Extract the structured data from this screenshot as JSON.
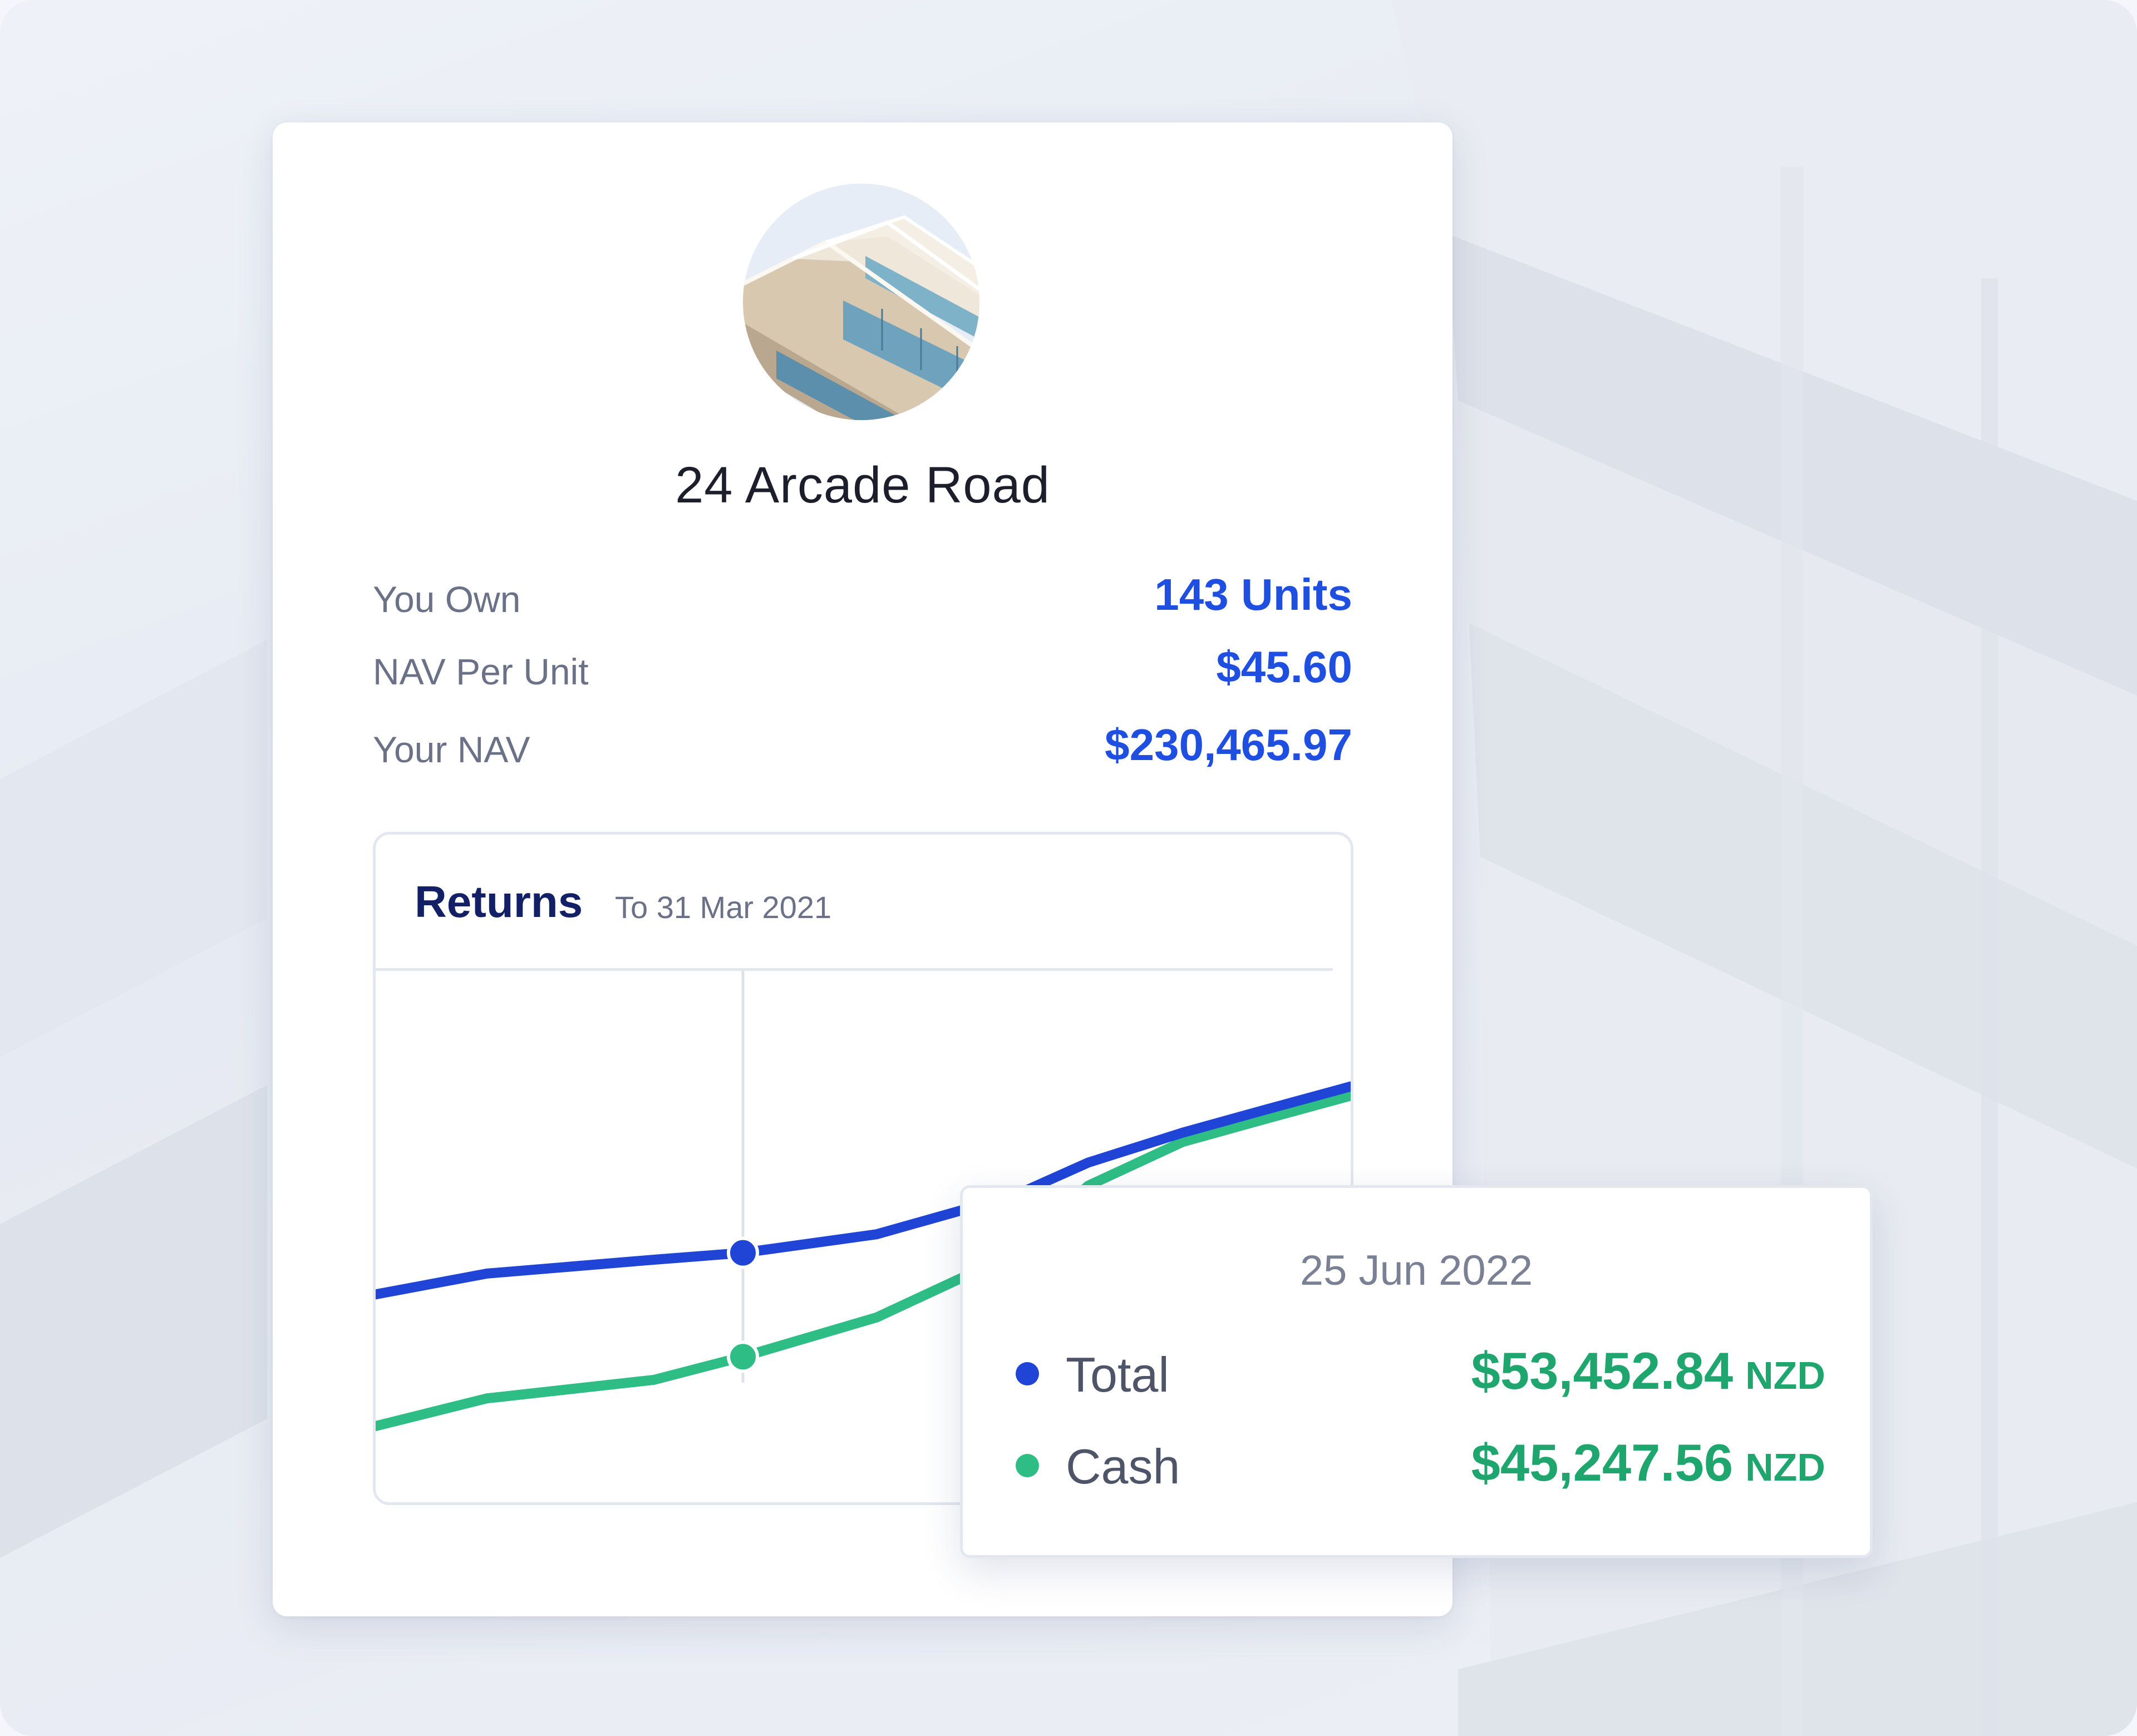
{
  "property": {
    "name": "24 Arcade Road",
    "image_icon": "building-photo"
  },
  "stats": [
    {
      "label": "You Own",
      "value": "143 Units"
    },
    {
      "label": "NAV Per Unit",
      "value": "$45.60"
    },
    {
      "label": "Your NAV",
      "value": "$230,465.97"
    }
  ],
  "returns": {
    "title": "Returns",
    "subtitle": "To 31 Mar 2021"
  },
  "tooltip": {
    "date": "25 Jun 2022",
    "rows": [
      {
        "label": "Total",
        "value": "$53,452.84",
        "currency": "NZD",
        "dot_color": "#1f44d6"
      },
      {
        "label": "Cash",
        "value": "$45,247.56",
        "currency": "NZD",
        "dot_color": "#2ebd85"
      }
    ]
  },
  "colors": {
    "accent_blue": "#1f44d6",
    "accent_green": "#2ebd85",
    "value_green": "#1fa56e"
  },
  "chart_data": {
    "type": "line",
    "x": [
      0,
      1,
      2,
      3,
      4,
      5,
      6,
      7,
      8,
      9
    ],
    "series": [
      {
        "values": [
          1.0,
          1.9,
          2.5,
          2.8,
          3.6,
          5.3,
          6.7,
          8.0,
          9.0,
          10.0
        ],
        "color": "#1f44d6"
      },
      {
        "values": [
          -4.7,
          -3.5,
          -2.7,
          -1.7,
          0.0,
          2.8,
          5.7,
          7.6,
          8.6,
          9.6
        ],
        "color": "#2ebd85"
      }
    ],
    "highlight_index": 3,
    "ylim": [
      -8,
      15
    ],
    "grid": false
  }
}
